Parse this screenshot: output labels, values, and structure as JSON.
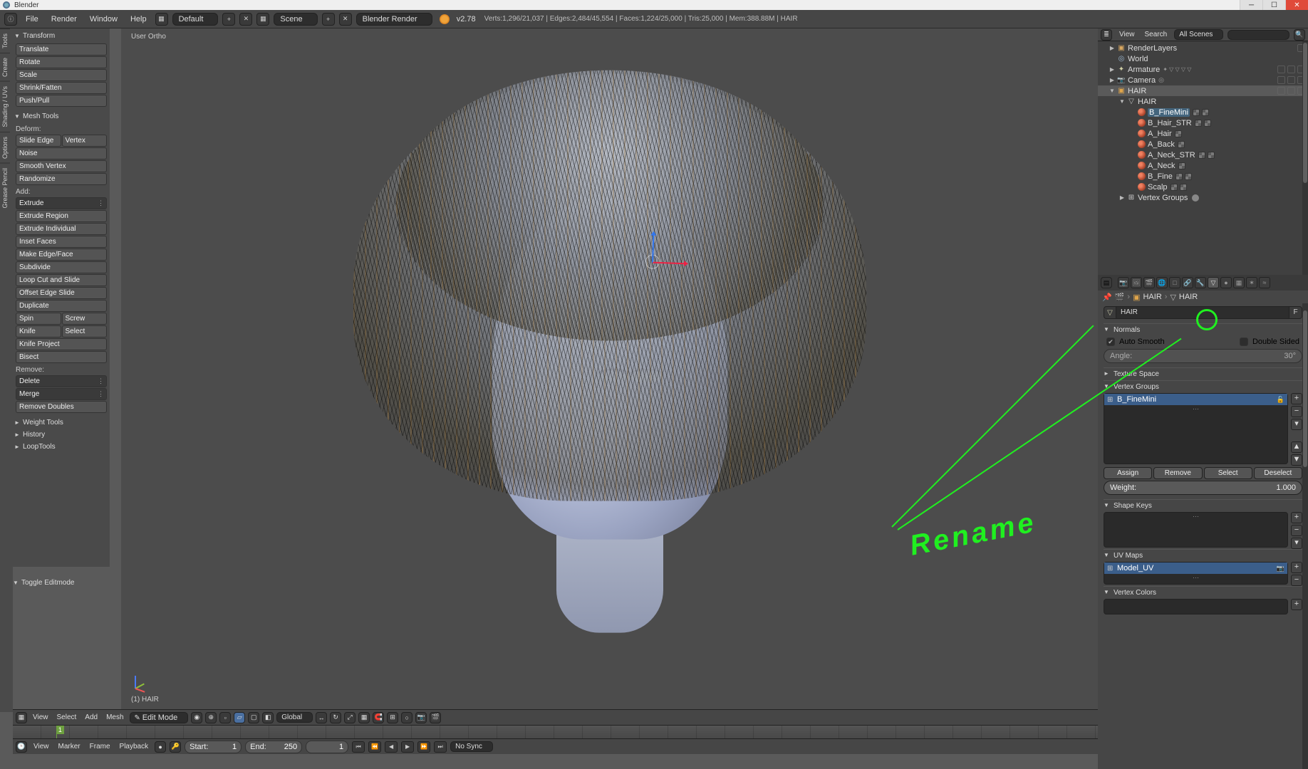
{
  "title": "Blender",
  "header": {
    "menu": [
      "File",
      "Render",
      "Window",
      "Help"
    ],
    "layout_dropdown": "Default",
    "scene_dropdown": "Scene",
    "engine_dropdown": "Blender Render",
    "version": "v2.78",
    "stats": "Verts:1,296/21,037 | Edges:2,484/45,554 | Faces:1,224/25,000 | Tris:25,000 | Mem:388.88M | HAIR"
  },
  "left_tabs": [
    "Tools",
    "Create",
    "Shading / UVs",
    "Options",
    "Grease Pencil"
  ],
  "toolshelf": {
    "transform": {
      "title": "Transform",
      "items": [
        "Translate",
        "Rotate",
        "Scale",
        "Shrink/Fatten",
        "Push/Pull"
      ]
    },
    "meshtools": {
      "title": "Mesh Tools",
      "deform_label": "Deform:",
      "slide_edge": "Slide Edge",
      "vertex": "Vertex",
      "noise": "Noise",
      "smooth_vertex": "Smooth Vertex",
      "randomize": "Randomize",
      "add_label": "Add:",
      "extrude": "Extrude",
      "add_ops": [
        "Extrude Region",
        "Extrude Individual",
        "Inset Faces",
        "Make Edge/Face",
        "Subdivide",
        "Loop Cut and Slide",
        "Offset Edge Slide",
        "Duplicate"
      ],
      "spin": "Spin",
      "screw": "Screw",
      "knife": "Knife",
      "select": "Select",
      "knife_project": "Knife Project",
      "bisect": "Bisect",
      "remove_label": "Remove:",
      "delete": "Delete",
      "merge": "Merge",
      "remove_doubles": "Remove Doubles"
    },
    "weight_tools": "Weight Tools",
    "history": "History",
    "looptools": "LoopTools",
    "toggle_editmode": "Toggle Editmode"
  },
  "viewport": {
    "label": "User Ortho",
    "object": "(1) HAIR"
  },
  "view3d_header": {
    "menus": [
      "View",
      "Select",
      "Add",
      "Mesh"
    ],
    "mode": "Edit Mode",
    "orientation": "Global"
  },
  "timeline": {
    "menus": [
      "View",
      "Marker",
      "Frame",
      "Playback"
    ],
    "start_label": "Start:",
    "start_val": "1",
    "end_label": "End:",
    "end_val": "250",
    "current_val": "1",
    "sync": "No Sync"
  },
  "outliner": {
    "menus": [
      "View",
      "Search"
    ],
    "filter": "All Scenes",
    "tree": [
      {
        "d": 1,
        "exp": "▶",
        "icon": "scene",
        "label": "RenderLayers",
        "right": [
          "box"
        ]
      },
      {
        "d": 1,
        "exp": "",
        "icon": "world",
        "label": "World"
      },
      {
        "d": 1,
        "exp": "▶",
        "icon": "arm",
        "label": "Armature",
        "mods": true,
        "right": [
          "eye",
          "cur",
          "rend"
        ]
      },
      {
        "d": 1,
        "exp": "▶",
        "icon": "cam",
        "label": "Camera",
        "cammod": true,
        "right": [
          "eye",
          "cur",
          "rend"
        ]
      },
      {
        "d": 1,
        "exp": "▼",
        "icon": "mesh",
        "label": "HAIR",
        "sel": true,
        "right": [
          "eye",
          "cur",
          "rend"
        ]
      },
      {
        "d": 2,
        "exp": "▼",
        "icon": "meshdata",
        "label": "HAIR"
      },
      {
        "d": 3,
        "exp": "",
        "icon": "mat",
        "label": "B_FineMini",
        "hilite": true,
        "mats": 2
      },
      {
        "d": 3,
        "exp": "",
        "icon": "mat",
        "label": "B_Hair_STR",
        "mats": 2
      },
      {
        "d": 3,
        "exp": "",
        "icon": "mat",
        "label": "A_Hair",
        "mats": 1
      },
      {
        "d": 3,
        "exp": "",
        "icon": "mat",
        "label": "A_Back",
        "mats": 1
      },
      {
        "d": 3,
        "exp": "",
        "icon": "mat",
        "label": "A_Neck_STR",
        "mats": 2
      },
      {
        "d": 3,
        "exp": "",
        "icon": "mat",
        "label": "A_Neck",
        "mats": 1
      },
      {
        "d": 3,
        "exp": "",
        "icon": "mat",
        "label": "B_Fine",
        "mats": 2
      },
      {
        "d": 3,
        "exp": "",
        "icon": "mat",
        "label": "Scalp",
        "mats": 2
      },
      {
        "d": 2,
        "exp": "▶",
        "icon": "vgroup",
        "label": "Vertex Groups",
        "dot": true
      }
    ]
  },
  "properties": {
    "breadcrumb_obj": "HAIR",
    "breadcrumb_data": "HAIR",
    "name_field": "HAIR",
    "f_btn": "F",
    "normals": {
      "title": "Normals",
      "auto_smooth": "Auto Smooth",
      "double_sided": "Double Sided",
      "angle_label": "Angle:",
      "angle_val": "30°"
    },
    "texture_space": "Texture Space",
    "vertex_groups": {
      "title": "Vertex Groups",
      "item": "B_FineMini",
      "assign": "Assign",
      "remove": "Remove",
      "select": "Select",
      "deselect": "Deselect",
      "weight_label": "Weight:",
      "weight_val": "1.000"
    },
    "shape_keys": "Shape Keys",
    "uv_maps": {
      "title": "UV Maps",
      "item": "Model_UV"
    },
    "vertex_colors": "Vertex Colors"
  },
  "annotation": {
    "text": "Rename"
  }
}
